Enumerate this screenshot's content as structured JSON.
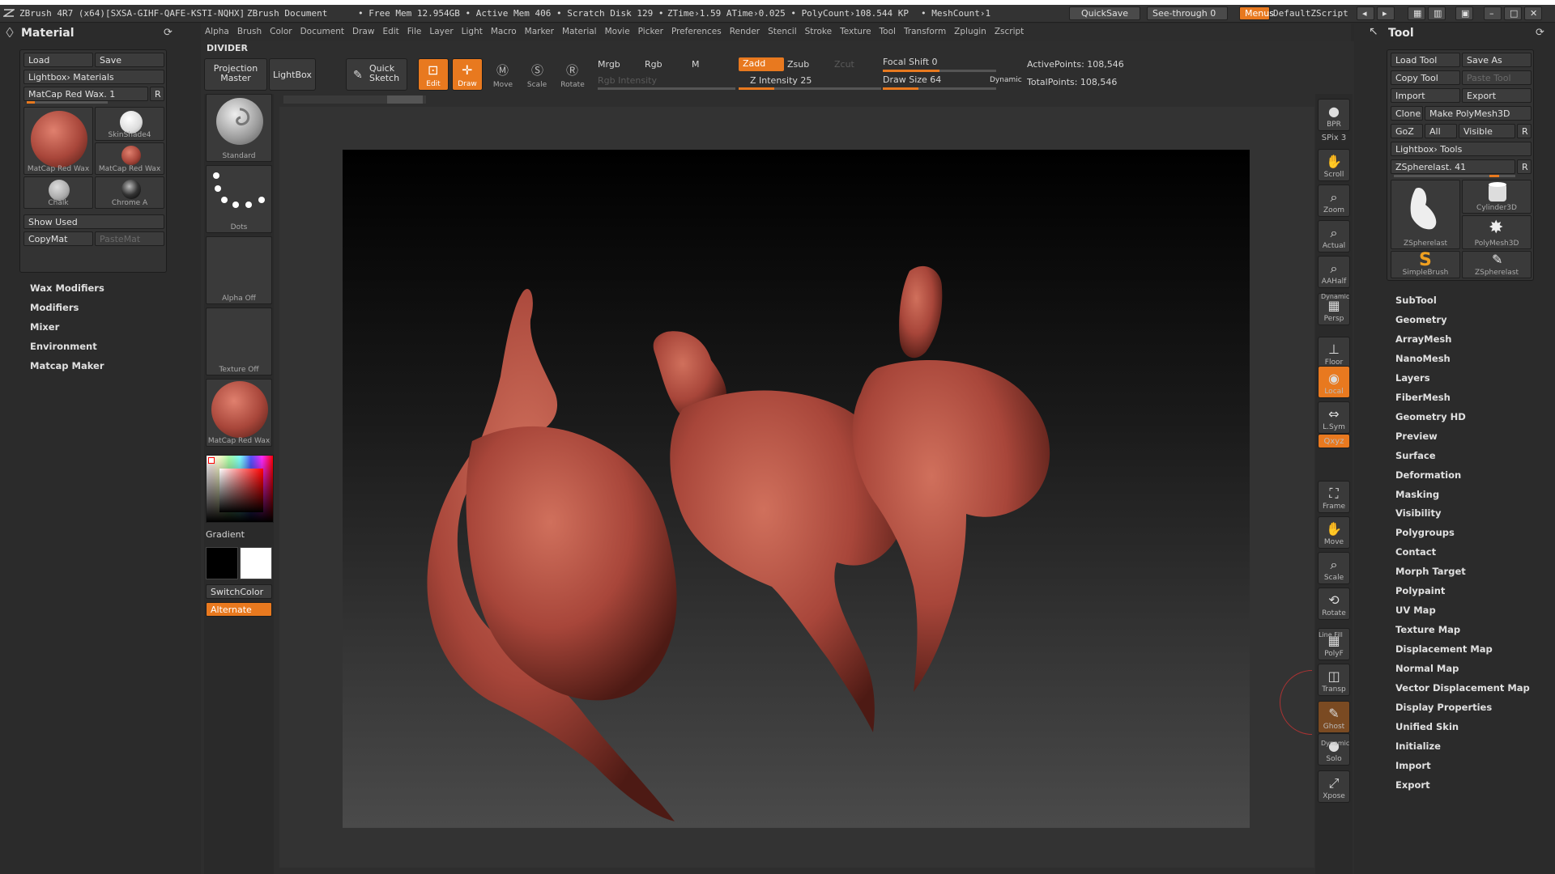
{
  "titlebar": {
    "app": "ZBrush 4R7 (x64)[SXSA-GIHF-QAFE-KSTI-NQHX]",
    "doc": "ZBrush Document",
    "stats": "• Free Mem 12.954GB • Active Mem 406 • Scratch Disk 129 •",
    "ztime": "ZTime›1.59  ATime›0.025 • PolyCount›108.544 KP",
    "meshcount": "• MeshCount›1",
    "quicksave": "QuickSave",
    "seethrough": "See-through  0",
    "menus": "Menus",
    "zscript": "DefaultZScript"
  },
  "menubar": [
    "Alpha",
    "Brush",
    "Color",
    "Document",
    "Draw",
    "Edit",
    "File",
    "Layer",
    "Light",
    "Macro",
    "Marker",
    "Material",
    "Movie",
    "Picker",
    "Preferences",
    "Render",
    "Stencil",
    "Stroke",
    "Texture",
    "Tool",
    "Transform",
    "Zplugin",
    "Zscript"
  ],
  "divider": "DIVIDER",
  "material_panel": {
    "title": "Material",
    "load": "Load",
    "save": "Save",
    "lightbox": "Lightbox› Materials",
    "current": "MatCap Red Wax. 1",
    "r": "R",
    "slots": [
      "MatCap Red Wax",
      "SkinShade4",
      "MatCap Red Wax",
      "Chalk",
      "Chrome A"
    ],
    "show_used": "Show Used",
    "copymat": "CopyMat",
    "pastemat": "PasteMat",
    "nav": [
      "Wax Modifiers",
      "Modifiers",
      "Mixer",
      "Environment",
      "Matcap Maker"
    ]
  },
  "toolbar": {
    "projection_master": "Projection Master",
    "lightbox": "LightBox",
    "quick_sketch": "Quick Sketch",
    "edit": "Edit",
    "draw": "Draw",
    "move": "Move",
    "scale": "Scale",
    "rotate": "Rotate",
    "mrgb": "Mrgb",
    "rgb": "Rgb",
    "m": "M",
    "rgb_intensity": "Rgb Intensity",
    "zadd": "Zadd",
    "zsub": "Zsub",
    "zcut": "Zcut",
    "z_intensity": "Z Intensity 25",
    "focal_shift": "Focal Shift 0",
    "draw_size": "Draw Size 64",
    "dynamic": "Dynamic",
    "active_points": "ActivePoints: 108,546",
    "total_points": "TotalPoints: 108,546"
  },
  "left_shelf": {
    "brush": "Standard",
    "stroke": "Dots",
    "alpha": "Alpha Off",
    "texture": "Texture Off",
    "material": "MatCap Red Wax",
    "gradient": "Gradient",
    "switchcolor": "SwitchColor",
    "alternate": "Alternate"
  },
  "right_shelf": [
    {
      "name": "bpr",
      "label": "BPR"
    },
    {
      "name": "spix",
      "label": "SPix 3"
    },
    {
      "name": "scroll",
      "label": "Scroll"
    },
    {
      "name": "zoom",
      "label": "Zoom"
    },
    {
      "name": "actual",
      "label": "Actual"
    },
    {
      "name": "aahalf",
      "label": "AAHalf"
    },
    {
      "name": "persp",
      "label": "Persp"
    },
    {
      "name": "floor",
      "label": "Floor"
    },
    {
      "name": "local",
      "label": "Local"
    },
    {
      "name": "lsym",
      "label": "L.Sym"
    },
    {
      "name": "xyz",
      "label": "Qxyz"
    },
    {
      "name": "frame",
      "label": "Frame"
    },
    {
      "name": "move",
      "label": "Move"
    },
    {
      "name": "scale",
      "label": "Scale"
    },
    {
      "name": "rotate",
      "label": "Rotate"
    },
    {
      "name": "polyf",
      "label": "PolyF"
    },
    {
      "name": "transp",
      "label": "Transp"
    },
    {
      "name": "ghost",
      "label": "Ghost"
    },
    {
      "name": "solo",
      "label": "Solo"
    },
    {
      "name": "xpose",
      "label": "Xpose"
    }
  ],
  "shelf_small": {
    "dynamic": "Dynamic",
    "linefill": "Line Fill",
    "dynamic2": "Dynamic"
  },
  "tool_panel": {
    "title": "Tool",
    "load_tool": "Load Tool",
    "save_as": "Save As",
    "copy_tool": "Copy Tool",
    "paste_tool": "Paste Tool",
    "import": "Import",
    "export": "Export",
    "clone": "Clone",
    "make_polymesh": "Make PolyMesh3D",
    "goz": "GoZ",
    "all": "All",
    "visible": "Visible",
    "r": "R",
    "lightbox": "Lightbox› Tools",
    "current": "ZSpherelast. 41",
    "tools": [
      "ZSpherelast",
      "Cylinder3D",
      "PolyMesh3D",
      "SimpleBrush",
      "ZSpherelast"
    ],
    "nav": [
      "SubTool",
      "Geometry",
      "ArrayMesh",
      "NanoMesh",
      "Layers",
      "FiberMesh",
      "Geometry HD",
      "Preview",
      "Surface",
      "Deformation",
      "Masking",
      "Visibility",
      "Polygroups",
      "Contact",
      "Morph Target",
      "Polypaint",
      "UV Map",
      "Texture Map",
      "Displacement Map",
      "Normal Map",
      "Vector Displacement Map",
      "Display Properties",
      "Unified Skin",
      "Initialize",
      "Import",
      "Export"
    ]
  },
  "colors": {
    "accent": "#e8791f",
    "wax": "#a8463a"
  }
}
